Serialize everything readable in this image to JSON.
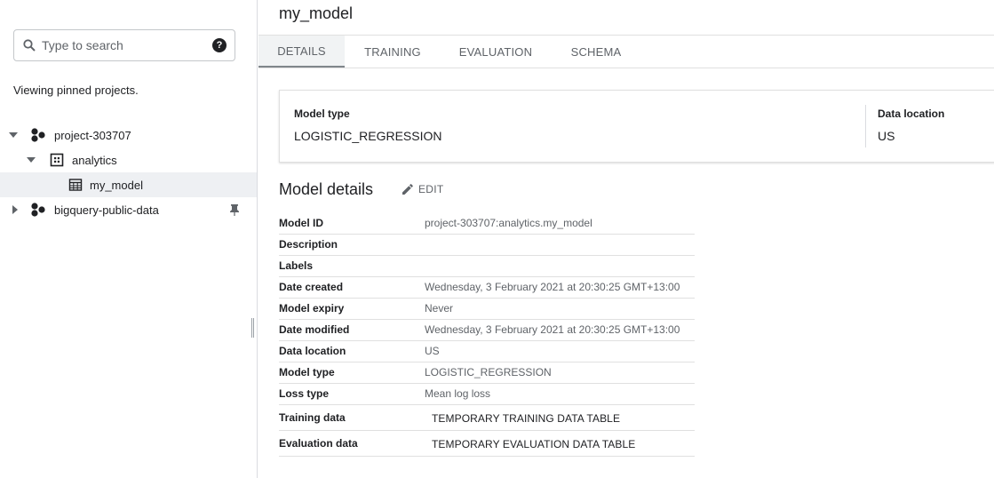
{
  "sidebar": {
    "search_placeholder": "Type to search",
    "pinned_note": "Viewing pinned projects.",
    "tree": {
      "project": "project-303707",
      "dataset": "analytics",
      "model": "my_model",
      "public_project": "bigquery-public-data"
    }
  },
  "main": {
    "title": "my_model",
    "tabs": [
      "DETAILS",
      "TRAINING",
      "EVALUATION",
      "SCHEMA"
    ],
    "active_tab": "DETAILS",
    "summary": {
      "model_type_label": "Model type",
      "model_type_value": "LOGISTIC_REGRESSION",
      "data_location_label": "Data location",
      "data_location_value": "US"
    },
    "details_heading": "Model details",
    "edit_label": "EDIT",
    "details_rows": [
      {
        "key": "Model ID",
        "value": "project-303707:analytics.my_model"
      },
      {
        "key": "Description",
        "value": ""
      },
      {
        "key": "Labels",
        "value": ""
      },
      {
        "key": "Date created",
        "value": "Wednesday, 3 February 2021 at 20:30:25 GMT+13:00"
      },
      {
        "key": "Model expiry",
        "value": "Never"
      },
      {
        "key": "Date modified",
        "value": "Wednesday, 3 February 2021 at 20:30:25 GMT+13:00"
      },
      {
        "key": "Data location",
        "value": "US"
      },
      {
        "key": "Model type",
        "value": "LOGISTIC_REGRESSION"
      },
      {
        "key": "Loss type",
        "value": "Mean log loss"
      },
      {
        "key": "Training data",
        "value": "TEMPORARY TRAINING DATA TABLE"
      },
      {
        "key": "Evaluation data",
        "value": "TEMPORARY EVALUATION DATA TABLE"
      }
    ]
  },
  "colors": {
    "text": "#202124",
    "muted": "#5f6368",
    "border": "#e0e0e0",
    "selected_row": "#eef0f3"
  }
}
